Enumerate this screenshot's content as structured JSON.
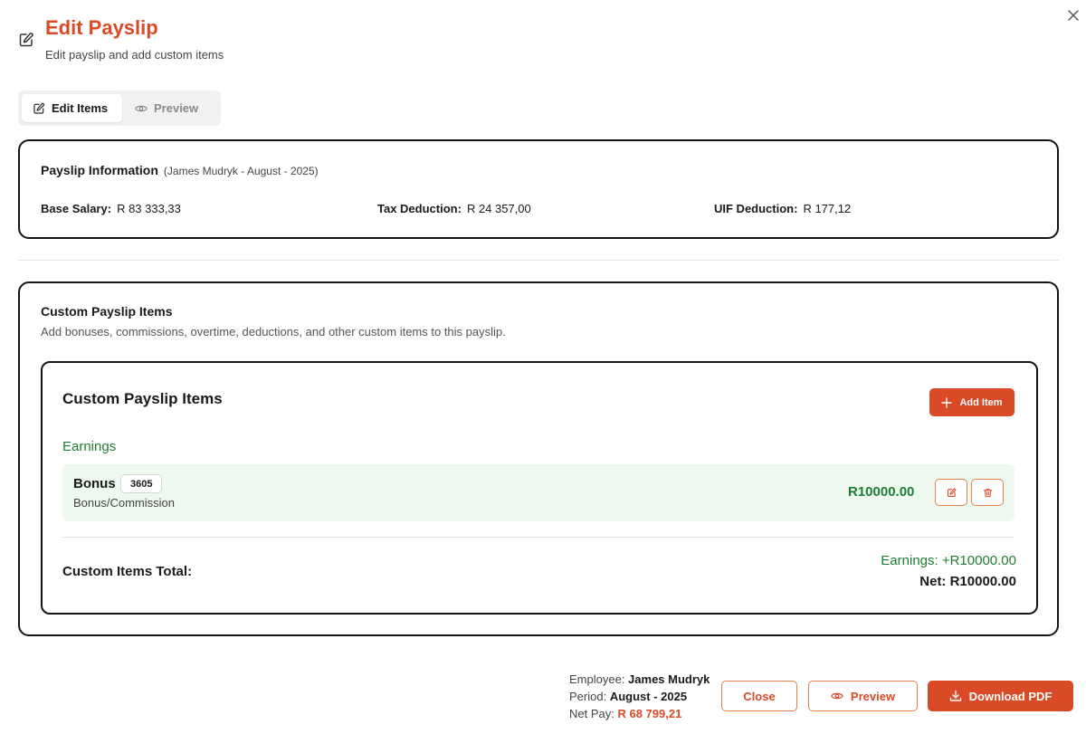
{
  "header": {
    "title": "Edit Payslip",
    "subtitle": "Edit payslip and add custom items",
    "icon": "pencil-square-icon",
    "close_icon": "close-icon"
  },
  "tabs": [
    {
      "label": "Edit Items",
      "icon": "pencil-square-icon",
      "active": true
    },
    {
      "label": "Preview",
      "icon": "eye-icon",
      "active": false
    }
  ],
  "payslip_info": {
    "title": "Payslip Information",
    "subtitle": "(James Mudryk - August - 2025)",
    "base_salary_label": "Base Salary:",
    "base_salary_value": "R 83 333,33",
    "tax_label": "Tax Deduction:",
    "tax_value": "R 24 357,00",
    "uif_label": "UIF Deduction:",
    "uif_value": "R 177,12"
  },
  "custom_section": {
    "title": "Custom Payslip Items",
    "description": "Add bonuses, commissions, overtime, deductions, and other custom items to this payslip.",
    "inner_title": "Custom Payslip Items",
    "add_button_label": "Add Item",
    "earnings_label": "Earnings",
    "items": [
      {
        "name": "Bonus",
        "badge": "3605",
        "category": "Bonus/Commission",
        "amount": "R10000.00"
      }
    ],
    "total_label": "Custom Items Total:",
    "total_earnings": "Earnings: +R10000.00",
    "total_net": "Net: R10000.00"
  },
  "footer": {
    "employee_label": "Employee:",
    "employee_value": "James Mudryk",
    "period_label": "Period:",
    "period_value": "August - 2025",
    "netpay_label": "Net Pay:",
    "netpay_value": "R 68 799,21",
    "close_label": "Close",
    "preview_label": "Preview",
    "download_label": "Download PDF"
  },
  "colors": {
    "accent": "#db4a26",
    "earnings_green": "#1e7d34",
    "earnings_bg": "#edf9ee"
  }
}
